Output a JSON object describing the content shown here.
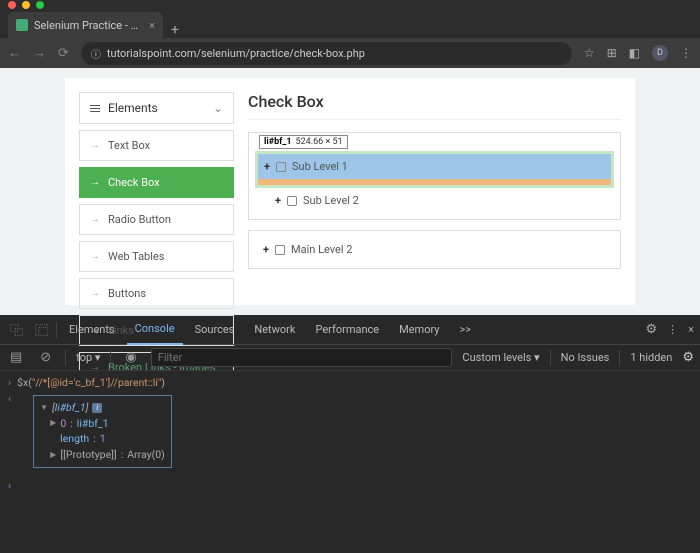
{
  "browser": {
    "tab_title": "Selenium Practice - Check B",
    "url": "tutorialspoint.com/selenium/practice/check-box.php",
    "avatar_letter": "D"
  },
  "sidebar": {
    "header": "Elements",
    "items": [
      {
        "label": "Text Box"
      },
      {
        "label": "Check Box"
      },
      {
        "label": "Radio Button"
      },
      {
        "label": "Web Tables"
      },
      {
        "label": "Buttons"
      },
      {
        "label": "Links"
      },
      {
        "label": "Broken Links - Images"
      }
    ]
  },
  "main": {
    "heading": "Check Box",
    "tooltip_selector": "li#bf_1",
    "tooltip_dims": "524.66 × 51",
    "tree1": [
      {
        "label": "Sub Level 1"
      },
      {
        "label": "Sub Level 2"
      }
    ],
    "tree2": [
      {
        "label": "Main Level 2"
      }
    ]
  },
  "devtools": {
    "tabs": [
      "Elements",
      "Console",
      "Sources",
      "Network",
      "Performance",
      "Memory"
    ],
    "more": ">>",
    "subbar": {
      "context": "top",
      "filter_placeholder": "Filter",
      "levels": "Custom levels",
      "issues": "No Issues",
      "hidden": "1 hidden"
    },
    "console": {
      "input_fn": "$x",
      "input_arg": "\"//*[@id='c_bf_1']//parent::li\"",
      "result_head_pre": "[",
      "result_head_el": "li#bf_1",
      "result_head_post": "]",
      "result_idx": "0",
      "result_idx_val": "li#bf_1",
      "result_len_key": "length",
      "result_len_val": "1",
      "result_proto_key": "[[Prototype]]",
      "result_proto_val": "Array(0)"
    }
  }
}
